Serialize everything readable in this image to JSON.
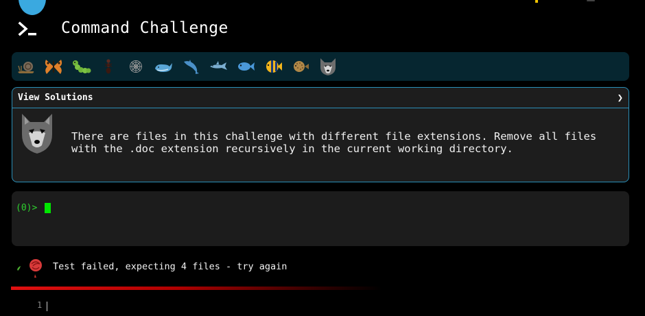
{
  "app": {
    "title": "Command Challenge"
  },
  "levels": [
    {
      "name": "snail-icon"
    },
    {
      "name": "butterfly-icon"
    },
    {
      "name": "caterpillar-icon"
    },
    {
      "name": "ant-icon"
    },
    {
      "name": "spider-web-icon"
    },
    {
      "name": "whale-icon"
    },
    {
      "name": "dolphin-jump-icon"
    },
    {
      "name": "dolphin-icon"
    },
    {
      "name": "fish-icon"
    },
    {
      "name": "tropical-fish-icon"
    },
    {
      "name": "pufferfish-icon"
    },
    {
      "name": "wolf-icon"
    }
  ],
  "challenge": {
    "header_label": "View Solutions",
    "chevron": "❯",
    "description": "There are files in this challenge with different file extensions. Remove all files\nwith the .doc extension recursively in the current working directory."
  },
  "terminal": {
    "prompt": "(0)>"
  },
  "result": {
    "message": "Test failed, expecting 4 files - try again"
  },
  "editor": {
    "line_number": "1"
  },
  "colors": {
    "accent": "#2a8fb8",
    "level_bar_bg": "#062630",
    "prompt_green": "#2fd12f",
    "fail_red": "#e01010"
  }
}
